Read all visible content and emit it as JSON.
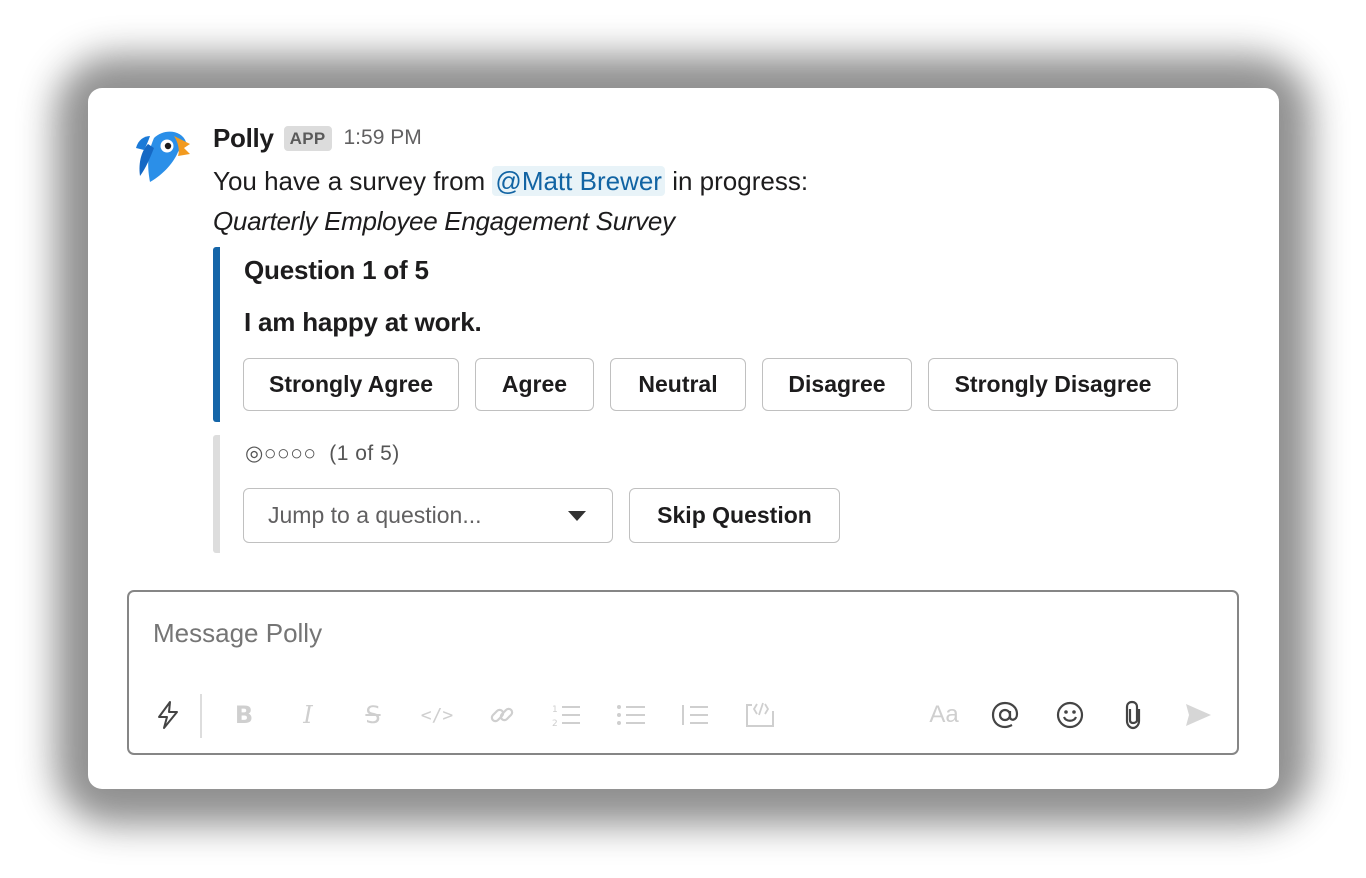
{
  "message": {
    "sender": "Polly",
    "badge": "APP",
    "time": "1:59 PM",
    "intro_prefix": "You have a survey from",
    "mention": "@Matt Brewer",
    "intro_suffix": "in progress:",
    "survey_title": "Quarterly Employee Engagement Survey"
  },
  "question": {
    "number_label": "Question 1 of 5",
    "text": "I am happy at work.",
    "answers": [
      "Strongly Agree",
      "Agree",
      "Neutral",
      "Disagree",
      "Strongly Disagree"
    ]
  },
  "progress": {
    "dots": "◎○○○○",
    "label": "(1 of 5)",
    "current": 1,
    "total": 5
  },
  "controls": {
    "jump_placeholder": "Jump to a question...",
    "skip_label": "Skip Question"
  },
  "composer": {
    "placeholder": "Message Polly",
    "text_size_label": "Aa"
  },
  "colors": {
    "accent_bar": "#1565a8",
    "mention_text": "#1264a3",
    "mention_bg": "#e8f3f8"
  },
  "icons": [
    "polly-parrot-icon",
    "shortcuts-bolt-icon",
    "bold-icon",
    "italic-icon",
    "strikethrough-icon",
    "code-icon",
    "link-icon",
    "ordered-list-icon",
    "bulleted-list-icon",
    "blockquote-icon",
    "code-block-icon",
    "mention-icon",
    "emoji-icon",
    "attachment-icon",
    "send-icon"
  ]
}
